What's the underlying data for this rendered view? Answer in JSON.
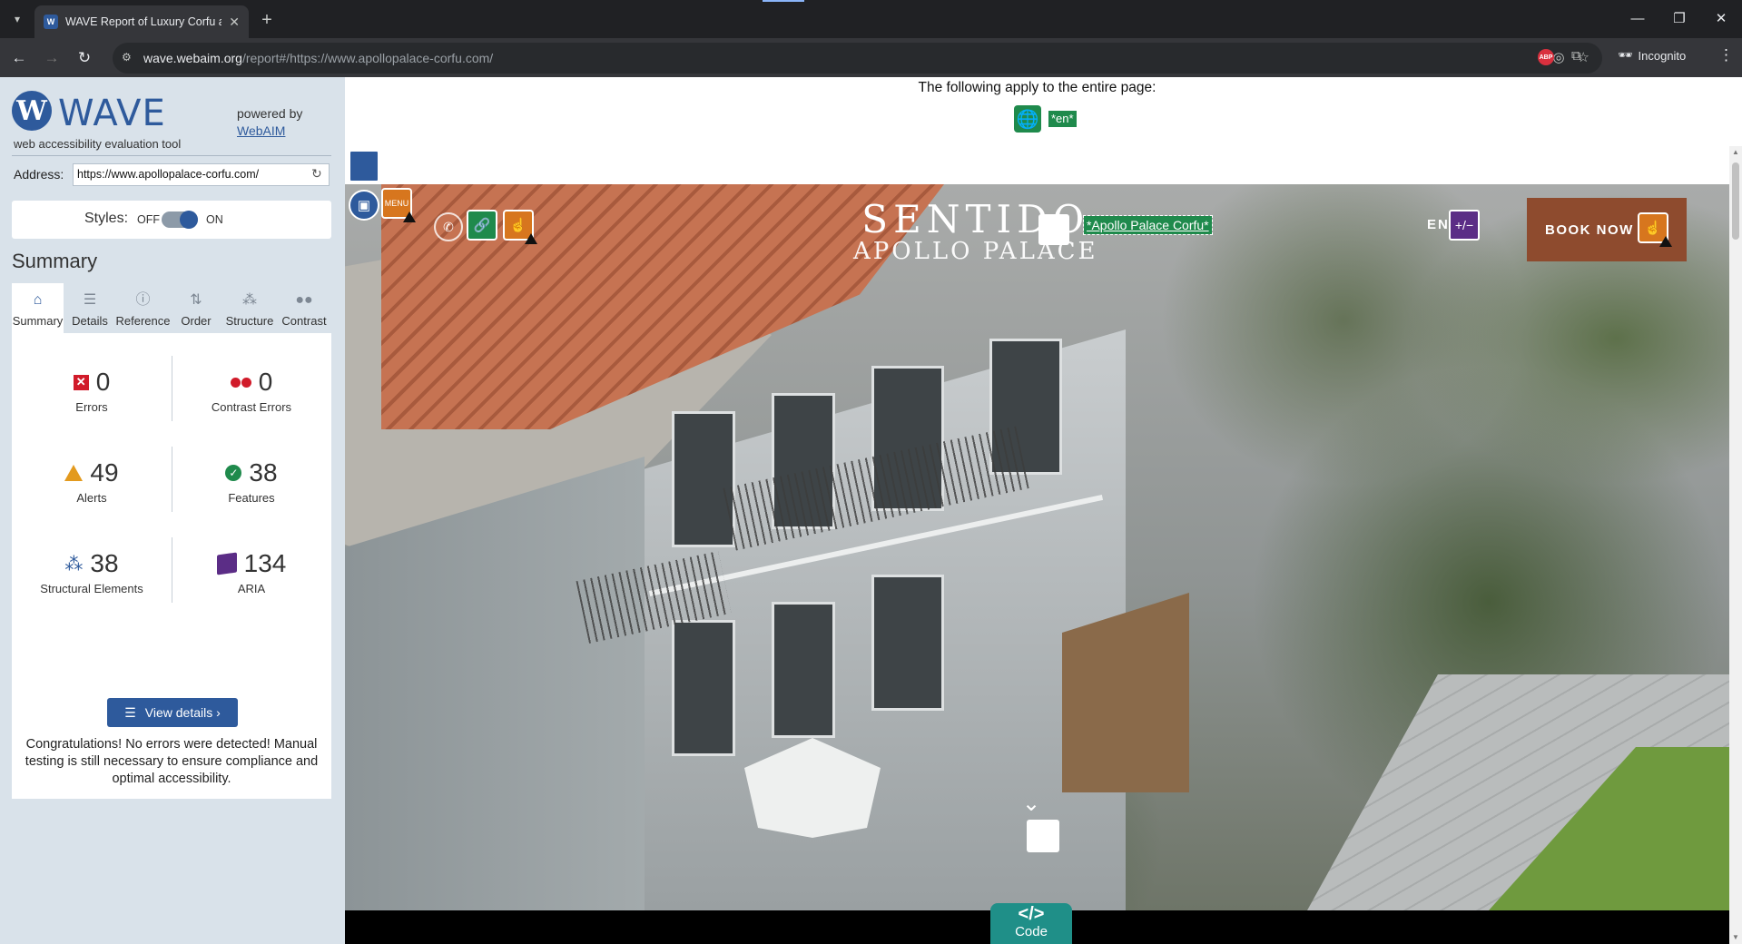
{
  "browser": {
    "tab_title": "WAVE Report of Luxury Corfu all",
    "tab_favicon": "W",
    "url_host": "wave.webaim.org",
    "url_rest": "/report#/https://www.apollopalace-corfu.com/",
    "incognito_label": "Incognito",
    "abp_label": "ABP"
  },
  "wave": {
    "logo_letter": "W",
    "title": "WAVE",
    "subtitle": "web accessibility evaluation tool",
    "powered_by": "powered by",
    "webaim_link": "WebAIM",
    "address_label": "Address:",
    "address_value": "https://www.apollopalace-corfu.com/",
    "styles_label": "Styles:",
    "styles_off": "OFF",
    "styles_on": "ON",
    "styles_state": "on",
    "summary_heading": "Summary",
    "tabs": [
      {
        "label": "Summary",
        "icon": "home-icon"
      },
      {
        "label": "Details",
        "icon": "list-icon"
      },
      {
        "label": "Reference",
        "icon": "info-icon"
      },
      {
        "label": "Order",
        "icon": "order-icon"
      },
      {
        "label": "Structure",
        "icon": "structure-icon"
      },
      {
        "label": "Contrast",
        "icon": "contrast-icon"
      }
    ],
    "stats": {
      "errors": {
        "value": "0",
        "label": "Errors"
      },
      "contrast_errors": {
        "value": "0",
        "label": "Contrast Errors"
      },
      "alerts": {
        "value": "49",
        "label": "Alerts"
      },
      "features": {
        "value": "38",
        "label": "Features"
      },
      "structural": {
        "value": "38",
        "label": "Structural Elements"
      },
      "aria": {
        "value": "134",
        "label": "ARIA"
      }
    },
    "view_details_label": "View details ›",
    "congrats": "Congratulations! No errors were detected! Manual testing is still necessary to ensure compliance and optimal accessibility.",
    "colors": {
      "brand_blue": "#2e5a9c",
      "error_red": "#d11b2a",
      "alert_orange": "#e39a1e",
      "feature_green": "#1f8a4c",
      "aria_purple": "#5b2d86"
    }
  },
  "page": {
    "entire_page_text": "The following apply to the entire page:",
    "lang_badge": "*en*",
    "logo_top": "SENTIDO",
    "logo_bottom": "APOLLO PALACE",
    "logo_link_text": "*Apollo Palace Corfu*",
    "lang_selector": "EN",
    "aria_plus": "+/−",
    "book_now": "BOOK NOW",
    "code_glyph": "</>",
    "code_label": "Code"
  }
}
